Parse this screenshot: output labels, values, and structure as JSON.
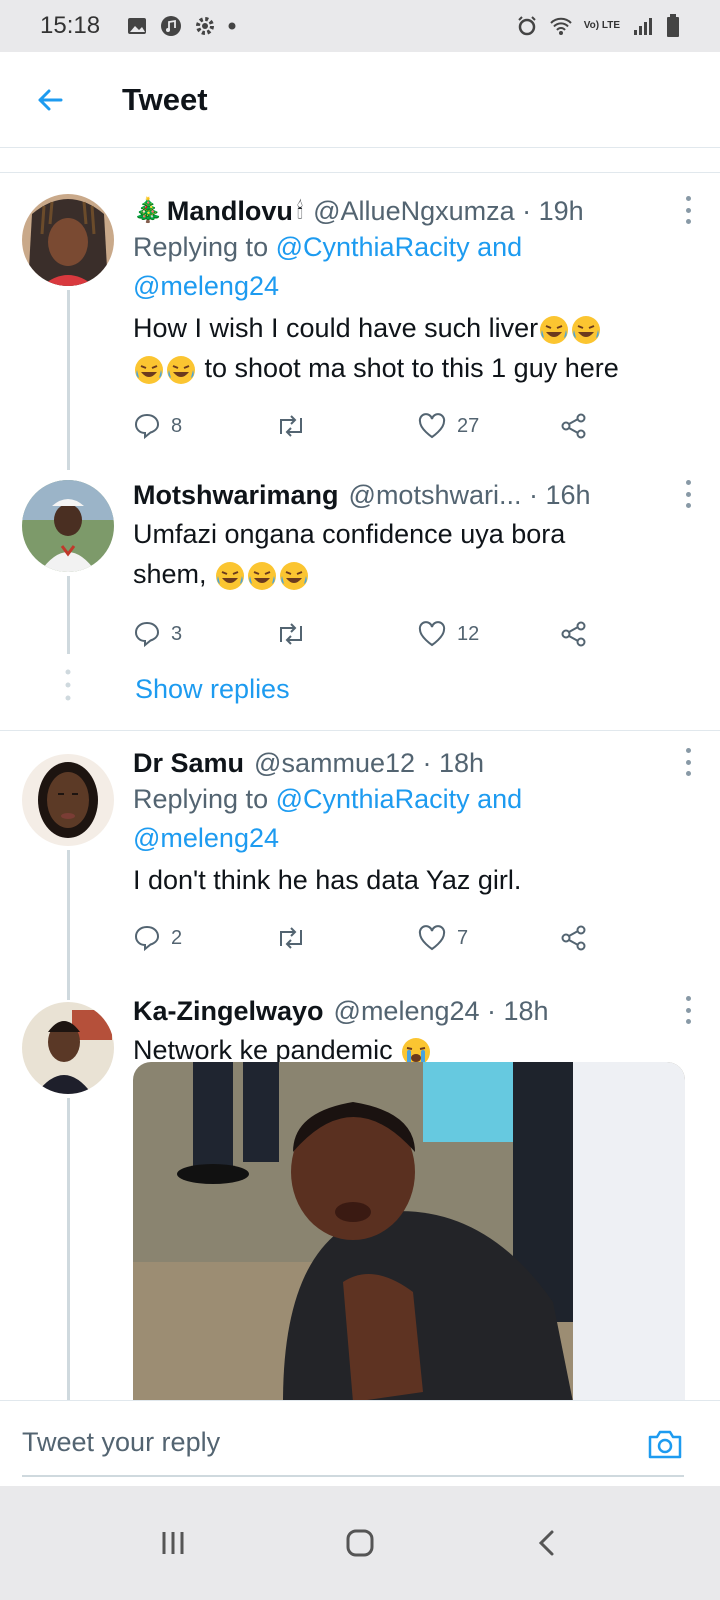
{
  "status_bar": {
    "time": "15:18",
    "network": "Vo) LTE"
  },
  "header": {
    "title": "Tweet"
  },
  "tweets": [
    {
      "name": "Mandlovu",
      "meta": "@AllueNgxumza · 19h",
      "replying_label": "Replying to",
      "mention1": "@CynthiaRacity",
      "and": "and",
      "mention2": "@meleng24",
      "text1": "How I wish I could have such liver",
      "text2": "to shoot ma shot to this 1 guy here",
      "replies": "8",
      "likes": "27"
    },
    {
      "name": "Motshwarimang",
      "meta": "@motshwari...  · 16h",
      "text1": "Umfazi ongana confidence uya bora",
      "text2": "shem,",
      "replies": "3",
      "likes": "12"
    },
    {
      "name": "Dr Samu",
      "meta": "@sammue12 · 18h",
      "replying_label": "Replying to",
      "mention1": "@CynthiaRacity",
      "and": "and",
      "mention2": "@meleng24",
      "text1": "I don't think he has data Yaz girl.",
      "replies": "2",
      "likes": "7"
    },
    {
      "name": "Ka-Zingelwayo",
      "meta": "@meleng24 · 18h",
      "text1": "Network ke pandemic"
    }
  ],
  "show_replies": "Show replies",
  "reply_bar": {
    "placeholder": "Tweet your reply"
  },
  "colors": {
    "accent": "#1d9bf0",
    "secondary_text": "#536471",
    "bar_bg": "#e9e9eb"
  },
  "icons": [
    "back-arrow-icon",
    "reply-icon",
    "retweet-icon",
    "like-icon",
    "share-icon",
    "camera-icon",
    "more-icon"
  ]
}
